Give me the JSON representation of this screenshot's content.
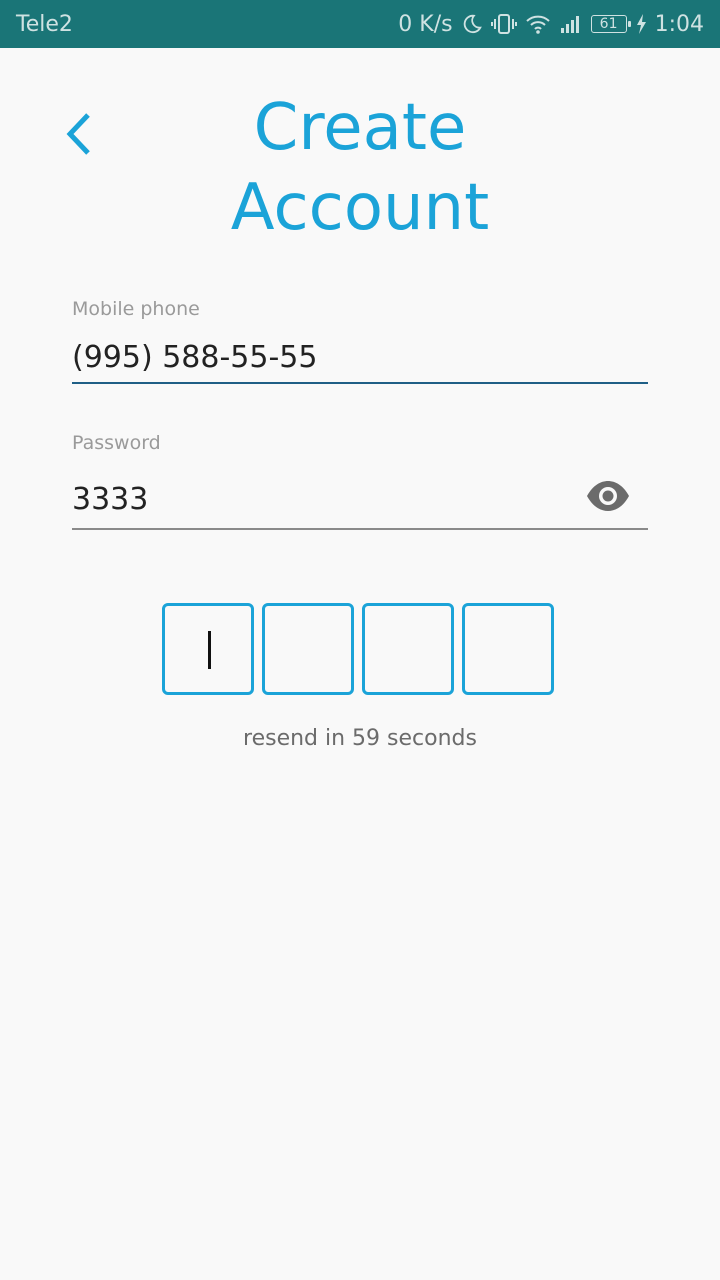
{
  "status_bar": {
    "carrier": "Tele2",
    "network_speed": "0 K/s",
    "battery": "61",
    "time": "1:04",
    "icons": [
      "moon-icon",
      "vibrate-icon",
      "wifi-icon",
      "signal-icon",
      "battery-icon",
      "charging-icon"
    ]
  },
  "header": {
    "back_icon": "chevron-left-icon",
    "title_line1": "Create",
    "title_line2": "Account"
  },
  "form": {
    "phone": {
      "label": "Mobile phone",
      "value": "(995) 588-55-55"
    },
    "password": {
      "label": "Password",
      "value": "3333",
      "toggle_icon": "eye-icon"
    }
  },
  "verification": {
    "code_digits": [
      "",
      "",
      "",
      ""
    ],
    "resend_text": "resend in 59 seconds"
  },
  "colors": {
    "status_bar": "#1a7577",
    "accent": "#1ba3d8",
    "background": "#f9f9f9"
  }
}
